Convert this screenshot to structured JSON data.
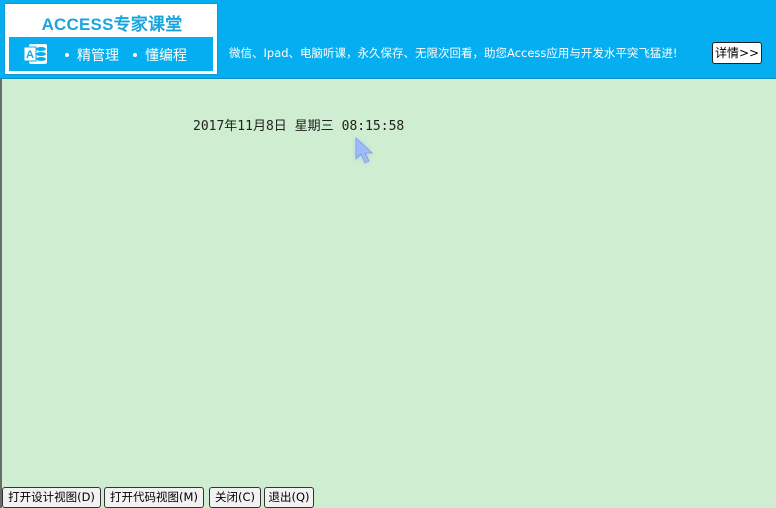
{
  "banner": {
    "logo_title": "ACCESS专家课堂",
    "slogan_1": "精管理",
    "slogan_2": "懂编程",
    "promo_text": "微信、Ipad、电脑听课，永久保存、无限次回看，助您Access应用与开发水平突飞猛进!",
    "detail_button": "详情>>",
    "icon": "access-icon",
    "colors": {
      "banner_bg": "#05aef0",
      "title_color": "#1aa5de"
    }
  },
  "form": {
    "date_text": "2017年11月8日 星期三",
    "time_text": "08:15:58",
    "background": "#cfedd0"
  },
  "buttons": {
    "open_design": "打开设计视图(D)",
    "open_code": "打开代码视图(M)",
    "close": "关闭(C)",
    "exit": "退出(Q)"
  }
}
